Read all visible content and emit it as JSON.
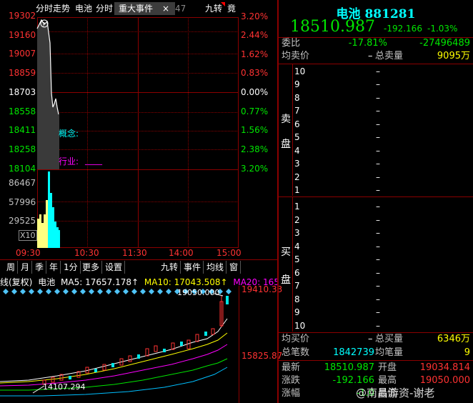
{
  "colors": {
    "up": "#ff3232",
    "down": "#00e600",
    "accent": "#00ffff",
    "grid": "#8b0000"
  },
  "top_tabs": [
    {
      "label": "分时走势"
    },
    {
      "label": "电池"
    },
    {
      "label": "分时"
    },
    {
      "label": "重大事件"
    },
    {
      "label": "×"
    },
    {
      "label": "47"
    },
    {
      "label": "九转"
    },
    {
      "label": "竟"
    }
  ],
  "price_axis": [
    "19302",
    "19160",
    "19007",
    "18859",
    "18703",
    "18558",
    "18411",
    "18258",
    "18104"
  ],
  "pct_axis": [
    "3.20%",
    "2.44%",
    "1.62%",
    "0.83%",
    "0.00%",
    "0.77%",
    "1.56%",
    "2.38%",
    "3.20%"
  ],
  "vol_axis": [
    "86467",
    "57996",
    "29525",
    "X10"
  ],
  "time_axis": [
    "09:30",
    "10:30",
    "11:30",
    "14:00",
    "15:00"
  ],
  "intraday_notes": {
    "concept": "概念:",
    "industry": "行业:",
    "industry_value": "____"
  },
  "bottom_tabs": [
    {
      "label": "周"
    },
    {
      "label": "月"
    },
    {
      "label": "季"
    },
    {
      "label": "年"
    },
    {
      "label": "1分"
    },
    {
      "label": "更多"
    },
    {
      "label": "设置"
    },
    {
      "label": "九转"
    },
    {
      "label": "事件"
    },
    {
      "label": "均线"
    },
    {
      "label": "窗"
    }
  ],
  "kline_header": {
    "mode": "线(复权)",
    "name": "电池",
    "ma5": "MA5: 17657.178↑",
    "ma10": "MA10: 17043.508↑",
    "ma20": "MA20: 165"
  },
  "kline_labels": {
    "high": "19050.000",
    "low": "14107.294",
    "axis_top": "19410.33",
    "axis_mid": "15825.87"
  },
  "stock": {
    "name": "电池",
    "code": "881281",
    "price": "18510.987",
    "change": "-192.166",
    "change_pct": "-1.03%"
  },
  "order_ratio": {
    "label": "委比",
    "pct": "-17.81%",
    "diff": "-27496489"
  },
  "ask_summary": {
    "label": "均卖价",
    "avg": "–",
    "total_label": "总卖量",
    "total": "9095万"
  },
  "sell_side": {
    "label1": "卖",
    "label2": "盘",
    "levels": [
      "10",
      "9",
      "8",
      "7",
      "6",
      "5",
      "4",
      "3",
      "2",
      "1"
    ],
    "price": "–",
    "vol": "–"
  },
  "buy_side": {
    "label1": "买",
    "label2": "盘",
    "levels": [
      "1",
      "2",
      "3",
      "4",
      "5",
      "6",
      "7",
      "8",
      "9",
      "10"
    ],
    "price": "–",
    "vol": "–"
  },
  "bid_summary": {
    "label": "均买价",
    "avg": "–",
    "total_label": "总买量",
    "total": "6346万"
  },
  "trades": {
    "label": "总笔数",
    "value": "1842739",
    "avg_label": "均笔量",
    "avg_value": "9"
  },
  "quote": [
    {
      "l1": "最新",
      "v1": "18510.987",
      "l2": "开盘",
      "v2": "19034.814"
    },
    {
      "l1": "涨跌",
      "v1": "-192.166",
      "l2": "最高",
      "v2": "19050.000"
    },
    {
      "l1": "涨幅",
      "v1": "-1.0",
      "l2": "最低",
      "v2": ""
    }
  ],
  "watermark": "@南昌游资-谢老"
}
